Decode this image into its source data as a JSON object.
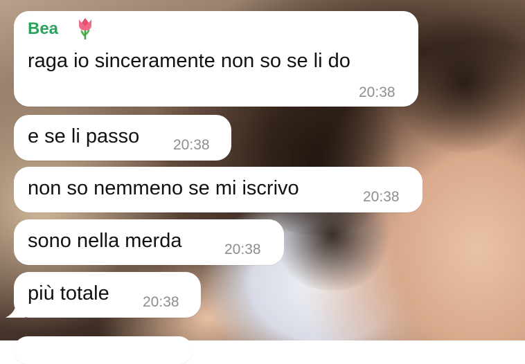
{
  "chat": {
    "sender": "Bea",
    "sender_emoji": "tulip-emoji",
    "accent_color": "#2aa35b",
    "messages": [
      {
        "text": "raga io sinceramente non so se li do",
        "time": "20:38"
      },
      {
        "text": "e se li passo",
        "time": "20:38"
      },
      {
        "text": "non so nemmeno se mi iscrivo",
        "time": "20:38"
      },
      {
        "text": "sono nella merda",
        "time": "20:38"
      },
      {
        "text": "più totale",
        "time": "20:38"
      }
    ]
  }
}
